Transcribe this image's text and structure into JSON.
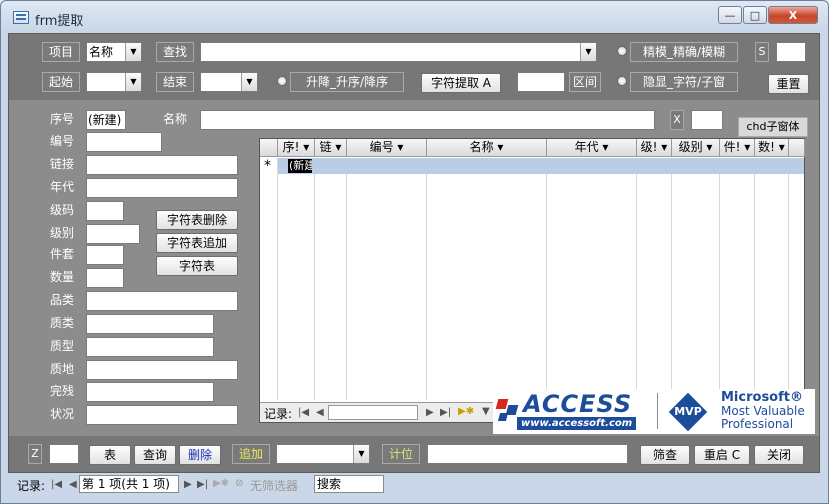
{
  "window": {
    "title": "frm提取",
    "minimize": "—",
    "maximize": "□",
    "close": "X"
  },
  "header": {
    "xiangmu_label": "项目",
    "xiangmu_value": "名称",
    "chazhao_label": "查找",
    "jingmo_label": "精模_精确/模糊",
    "s_label": "S",
    "qishi_label": "起始",
    "jieshu_label": "结束",
    "sort_label": "升降_升序/降序",
    "extract_button": "字符提取 A",
    "qujian_label": "区间",
    "hide_label": "隐显_字符/子窗",
    "reset_button": "重置"
  },
  "detail": {
    "xuhao_label": "序号",
    "xuhao_value": "(新建)",
    "mingcheng_label": "名称",
    "x_label": "X",
    "chd_label": "chd子窗体",
    "fields": [
      "编号",
      "链接",
      "年代",
      "级码",
      "级别",
      "件套",
      "数量",
      "品类",
      "质类",
      "质型",
      "质地",
      "完残",
      "状况"
    ],
    "buttons": {
      "delete": "字符表删除",
      "append": "字符表追加",
      "table": "字符表"
    }
  },
  "grid": {
    "columns": [
      "序!",
      "链",
      "编号",
      "名称",
      "年代",
      "级!",
      "级别",
      "件!",
      "数!"
    ],
    "new_row_marker": "*",
    "new_row_value": "(新建",
    "nav_label": "记录:"
  },
  "logo": {
    "access": "ACCESS",
    "url": "www.accessoft.com",
    "mvp": "MVP",
    "ms": "Microsoft®",
    "mvp1": "Most Valuable",
    "mvp2": "Professional"
  },
  "footer": {
    "z_label": "Z",
    "table_button": "表",
    "query_button": "查询",
    "delete_button": "删除",
    "append_label": "追加",
    "jiwei_label": "计位",
    "shaicha_button": "筛查",
    "restart_button": "重启 C",
    "close_button": "关闭"
  },
  "status": {
    "record_label": "记录:",
    "record_value": "第 1 项(共 1 项)",
    "filter_label": "无筛选器",
    "search_label": "搜索"
  }
}
